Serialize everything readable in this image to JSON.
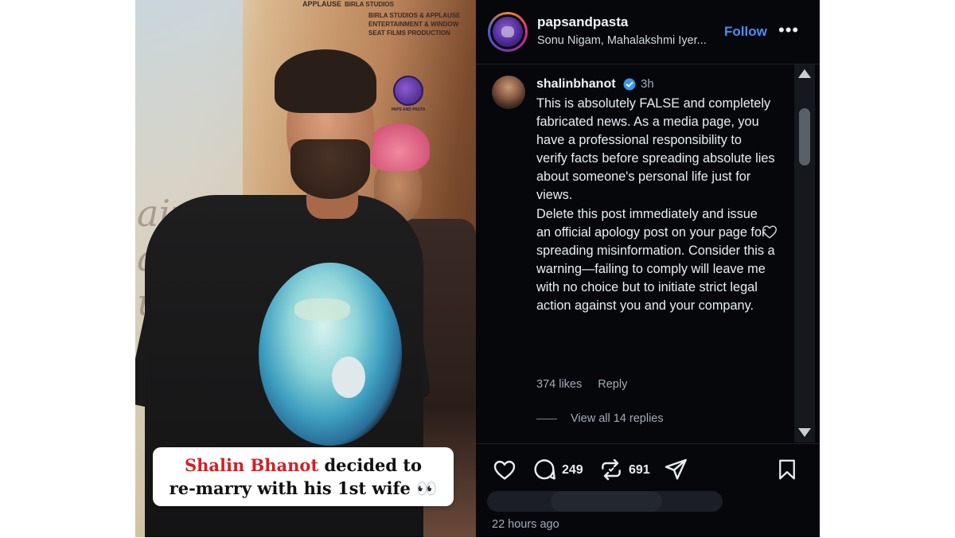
{
  "image": {
    "poster_credits": {
      "applause": "APPLAUSE",
      "birla": "BIRLA STUDIOS",
      "presents": "BIRLA STUDIOS & APPLAUSE ENTERTAINMENT & WINDOW SEAT FILMS PRODUCTION"
    },
    "watermark": "PAPS AND PASTA",
    "caption_highlight": "Shalin Bhanot",
    "caption_rest_1": " decided to",
    "caption_line2": "re-marry with his 1st wife 👀"
  },
  "post_header": {
    "username": "papsandpasta",
    "audio_line": "Sonu Nigam, Mahalakshmi Iyer...",
    "follow_label": "Follow",
    "more_label": "•••"
  },
  "comment": {
    "username": "shalinbhanot",
    "time": "3h",
    "paragraph1": "This is absolutely FALSE and completely fabricated news. As a media page, you have a professional responsibility to verify facts before spreading absolute lies about someone's personal life just for views.",
    "paragraph2": "Delete this post immediately and issue an official apology post on your page for spreading misinformation. Consider this a warning—failing to comply will leave me with no choice but to initiate strict legal action against you and your company.",
    "likes": "374 likes",
    "reply_label": "Reply",
    "view_replies": "View all 14 replies"
  },
  "actions": {
    "comments_count": "249",
    "reposts_count": "691"
  },
  "timestamp": "22 hours ago",
  "colors": {
    "panel_bg": "#05070b",
    "follow_blue": "#4d8df6",
    "verified_blue": "#3897f0",
    "caption_red": "#d21f25"
  },
  "icons": [
    "heart-icon",
    "comment-icon",
    "repost-icon",
    "share-icon",
    "bookmark-icon",
    "verified-icon",
    "more-icon"
  ]
}
